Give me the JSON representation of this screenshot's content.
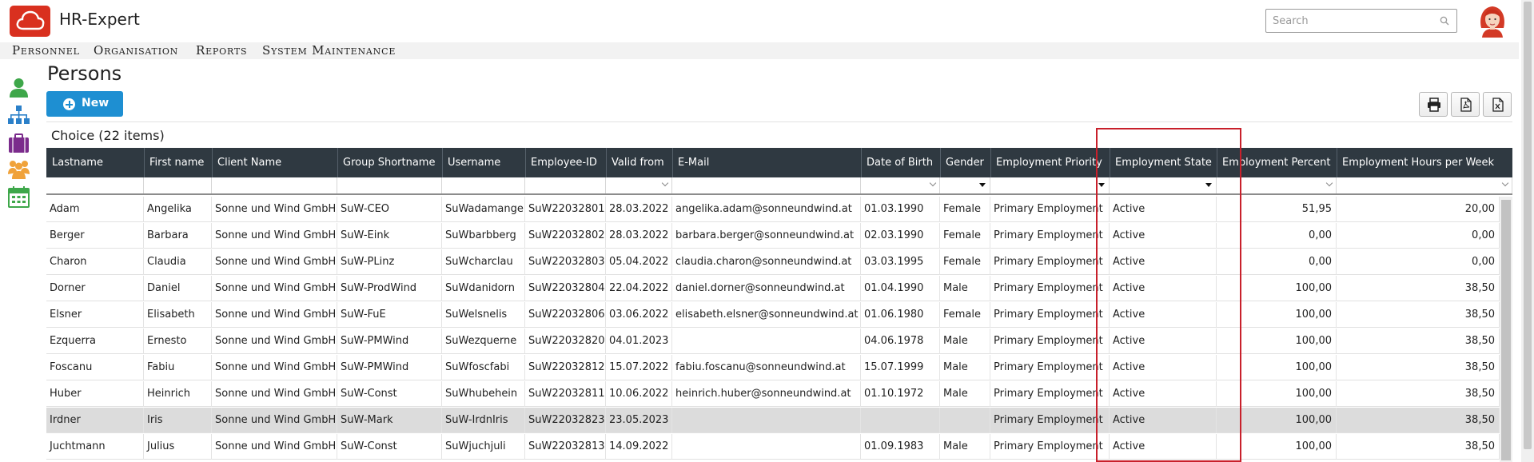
{
  "app": {
    "title": "HR-Expert"
  },
  "search": {
    "placeholder": "Search",
    "value": ""
  },
  "menu": [
    "Personnel",
    "Organisation",
    "Reports",
    "System Maintenance"
  ],
  "page": {
    "title": "Persons",
    "new_label": "New",
    "choice_label": "Choice",
    "choice_count": "(22 items)"
  },
  "table": {
    "columns": [
      "Lastname",
      "First name",
      "Client Name",
      "Group Shortname",
      "Username",
      "Employee-ID",
      "Valid from",
      "E-Mail",
      "Date of Birth",
      "Gender",
      "Employment Priority",
      "Employment State",
      "Employment Percent",
      "Employment Hours per Week"
    ],
    "rows": [
      [
        "Adam",
        "Angelika",
        "Sonne und Wind GmbH",
        "SuW-CEO",
        "SuWadamange",
        "SuW22032801",
        "28.03.2022",
        "angelika.adam@sonneundwind.at",
        "01.03.1990",
        "Female",
        "Primary Employment",
        "Active",
        "51,95",
        "20,00"
      ],
      [
        "Berger",
        "Barbara",
        "Sonne und Wind GmbH",
        "SuW-Eink",
        "SuWbarbberg",
        "SuW22032802",
        "28.03.2022",
        "barbara.berger@sonneundwind.at",
        "02.03.1990",
        "Female",
        "Primary Employment",
        "Active",
        "0,00",
        "0,00"
      ],
      [
        "Charon",
        "Claudia",
        "Sonne und Wind GmbH",
        "SuW-PLinz",
        "SuWcharclau",
        "SuW22032803",
        "05.04.2022",
        "claudia.charon@sonneundwind.at",
        "03.03.1995",
        "Female",
        "Primary Employment",
        "Active",
        "0,00",
        "0,00"
      ],
      [
        "Dorner",
        "Daniel",
        "Sonne und Wind GmbH",
        "SuW-ProdWind",
        "SuWdanidorn",
        "SuW22032804",
        "22.04.2022",
        "daniel.dorner@sonneundwind.at",
        "01.04.1990",
        "Male",
        "Primary Employment",
        "Active",
        "100,00",
        "38,50"
      ],
      [
        "Elsner",
        "Elisabeth",
        "Sonne und Wind GmbH",
        "SuW-FuE",
        "SuWelsnelis",
        "SuW22032806",
        "03.06.2022",
        "elisabeth.elsner@sonneundwind.at",
        "01.06.1980",
        "Female",
        "Primary Employment",
        "Active",
        "100,00",
        "38,50"
      ],
      [
        "Ezquerra",
        "Ernesto",
        "Sonne und Wind GmbH",
        "SuW-PMWind",
        "SuWezquerne",
        "SuW22032820",
        "04.01.2023",
        "",
        "04.06.1978",
        "Male",
        "Primary Employment",
        "Active",
        "100,00",
        "38,50"
      ],
      [
        "Foscanu",
        "Fabiu",
        "Sonne und Wind GmbH",
        "SuW-PMWind",
        "SuWfoscfabi",
        "SuW22032812",
        "15.07.2022",
        "fabiu.foscanu@sonneundwind.at",
        "15.07.1999",
        "Male",
        "Primary Employment",
        "Active",
        "100,00",
        "38,50"
      ],
      [
        "Huber",
        "Heinrich",
        "Sonne und Wind GmbH",
        "SuW-Const",
        "SuWhubehein",
        "SuW22032811",
        "10.06.2022",
        "heinrich.huber@sonneundwind.at",
        "01.10.1972",
        "Male",
        "Primary Employment",
        "Active",
        "100,00",
        "38,50"
      ],
      [
        "Irdner",
        "Iris",
        "Sonne und Wind GmbH",
        "SuW-Mark",
        "SuW-IrdnIris",
        "SuW22032823",
        "23.05.2023",
        "",
        "",
        "",
        "Primary Employment",
        "Active",
        "100,00",
        "38,50"
      ],
      [
        "Juchtmann",
        "Julius",
        "Sonne und Wind GmbH",
        "SuW-Const",
        "SuWjuchjuli",
        "SuW22032813",
        "14.09.2022",
        "",
        "01.09.1983",
        "Male",
        "Primary Employment",
        "Active",
        "100,00",
        "38,50"
      ]
    ]
  }
}
